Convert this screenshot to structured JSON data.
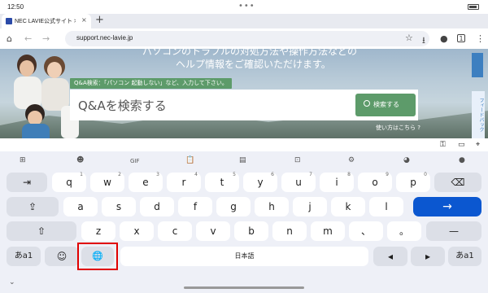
{
  "status": {
    "time": "12:50",
    "dots": "•••"
  },
  "tab": {
    "title": "NEC LAVIE公式サイト > サ",
    "close": "×",
    "new_tab": "+"
  },
  "toolbar": {
    "url": "support.nec-lavie.jp"
  },
  "page": {
    "hero_line1": "パソコンのトラブルの対処方法や操作方法などの",
    "hero_line2": "ヘルプ情報をご確認いただけます。",
    "hint": "Q&A検索：「パソコン 起動しない」など、入力して下さい。",
    "search_placeholder": "Q&Aを検索する",
    "search_button": "検索する",
    "howto": "使い方はこちら ?",
    "side_tab": "フィードバック"
  },
  "keyboard": {
    "toolbar_gif": "GIF",
    "row1": [
      {
        "label": "⇥",
        "sup": ""
      },
      {
        "label": "q",
        "sup": "1"
      },
      {
        "label": "w",
        "sup": "2"
      },
      {
        "label": "e",
        "sup": "3"
      },
      {
        "label": "r",
        "sup": "4"
      },
      {
        "label": "t",
        "sup": "5"
      },
      {
        "label": "y",
        "sup": "6"
      },
      {
        "label": "u",
        "sup": "7"
      },
      {
        "label": "i",
        "sup": "8"
      },
      {
        "label": "o",
        "sup": "9"
      },
      {
        "label": "p",
        "sup": "0"
      },
      {
        "label": "⌫",
        "sup": ""
      }
    ],
    "row2": [
      "⇪",
      "a",
      "s",
      "d",
      "f",
      "g",
      "h",
      "j",
      "k",
      "l",
      "→"
    ],
    "row3": [
      "⇧",
      "z",
      "x",
      "c",
      "v",
      "b",
      "n",
      "m",
      "、",
      "。",
      "—"
    ],
    "row4": {
      "mode_left": "あa1",
      "emoji": "☺",
      "globe": "🌐",
      "space": "日本語",
      "left": "◂",
      "right": "▸",
      "mode_right": "あa1"
    },
    "collapse": "⌄"
  }
}
